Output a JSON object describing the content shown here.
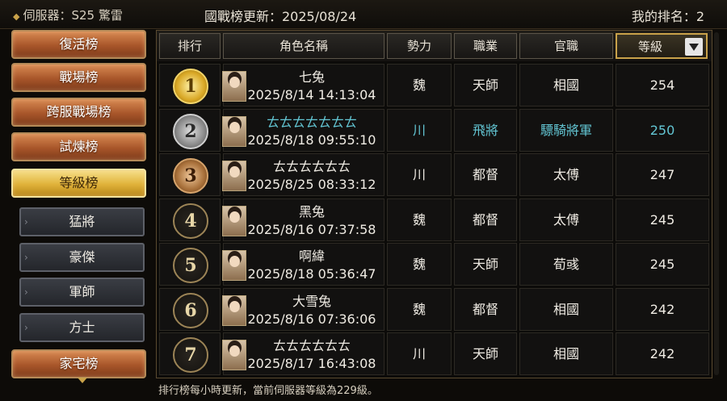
{
  "header": {
    "server": "伺服器：S25 驚雷",
    "update": "國戰榜更新：2025/08/24",
    "my_rank": "我的排名：2"
  },
  "sidebar": {
    "categories": [
      {
        "label": "復活榜"
      },
      {
        "label": "戰場榜"
      },
      {
        "label": "跨服戰場榜"
      },
      {
        "label": "試煉榜"
      },
      {
        "label": "等級榜"
      },
      {
        "label": "家宅榜"
      }
    ],
    "subs": [
      {
        "label": "猛將"
      },
      {
        "label": "豪傑"
      },
      {
        "label": "軍師"
      },
      {
        "label": "方士"
      }
    ]
  },
  "table": {
    "columns": [
      "排行",
      "角色名稱",
      "勢力",
      "職業",
      "官職",
      "等級"
    ],
    "sort_icon": "dropdown-triangle-icon",
    "rows": [
      {
        "rank": "1",
        "name": "七兔",
        "time": "2025/8/14 14:13:04",
        "faction": "魏",
        "job": "天師",
        "title": "相國",
        "level": "254"
      },
      {
        "rank": "2",
        "name": "ㄊㄊㄊㄊㄊㄊㄊ",
        "time": "2025/8/18 09:55:10",
        "faction": "川",
        "job": "飛將",
        "title": "驃騎將軍",
        "level": "250"
      },
      {
        "rank": "3",
        "name": "ㄊㄊㄊㄊㄊㄊ",
        "time": "2025/8/25 08:33:12",
        "faction": "川",
        "job": "都督",
        "title": "太傅",
        "level": "247"
      },
      {
        "rank": "4",
        "name": "黑兔",
        "time": "2025/8/16 07:37:58",
        "faction": "魏",
        "job": "都督",
        "title": "太傅",
        "level": "245"
      },
      {
        "rank": "5",
        "name": "啊緯",
        "time": "2025/8/18 05:36:47",
        "faction": "魏",
        "job": "天師",
        "title": "荀彧",
        "level": "245"
      },
      {
        "rank": "6",
        "name": "大雪兔",
        "time": "2025/8/16 07:36:06",
        "faction": "魏",
        "job": "都督",
        "title": "相國",
        "level": "242"
      },
      {
        "rank": "7",
        "name": "ㄊㄊㄊㄊㄊㄊ",
        "time": "2025/8/17 16:43:08",
        "faction": "川",
        "job": "天師",
        "title": "相國",
        "level": "242"
      }
    ]
  },
  "footer": {
    "note": "排行榜每小時更新，當前伺服器等級為229級。"
  },
  "colors": {
    "highlight_row": "#63c6d4",
    "active_tab": "#e0b23a",
    "tab": "#a8562a"
  }
}
